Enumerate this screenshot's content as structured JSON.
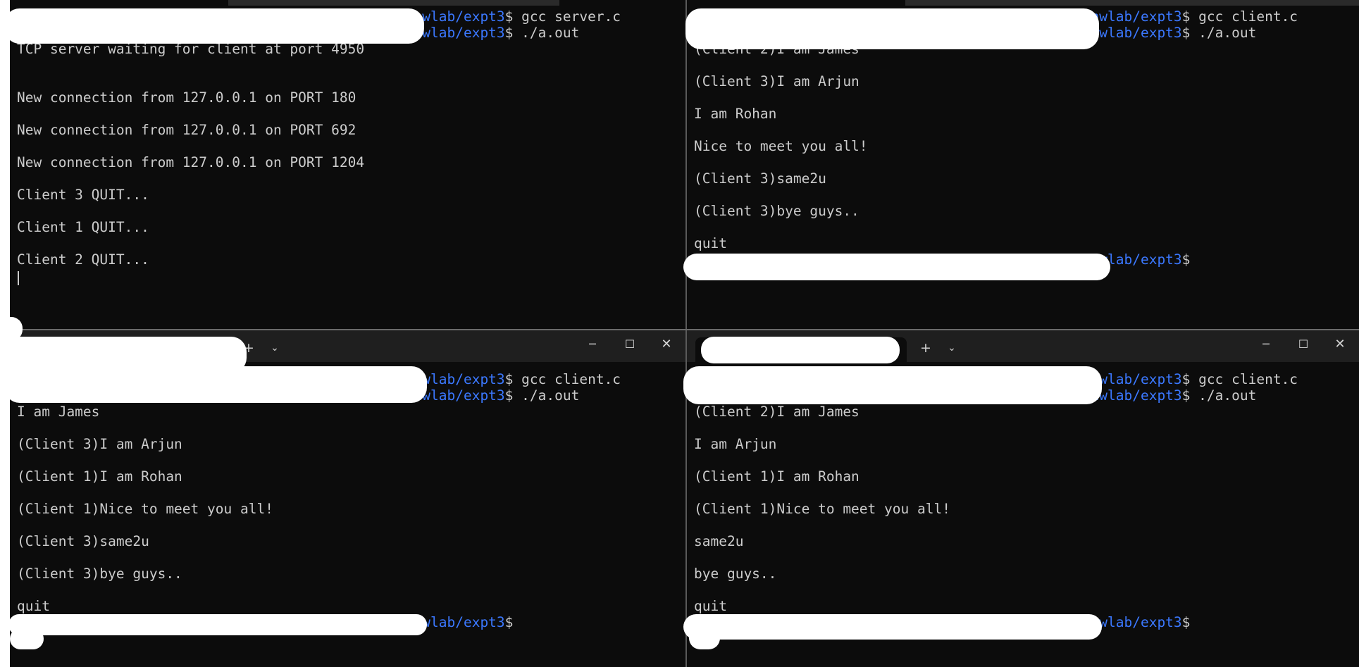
{
  "panes": {
    "tl": {
      "lines": [
        {
          "kind": "prompt",
          "path": "/nwlab/expt3",
          "cmd": "gcc server.c"
        },
        {
          "kind": "prompt",
          "path": "/nwlab/expt3",
          "cmd": "./a.out"
        },
        {
          "kind": "text",
          "text": "TCP server waiting for client at port 4950"
        },
        {
          "kind": "blank"
        },
        {
          "kind": "blank"
        },
        {
          "kind": "text",
          "text": "New connection from 127.0.0.1 on PORT 180"
        },
        {
          "kind": "blank"
        },
        {
          "kind": "text",
          "text": "New connection from 127.0.0.1 on PORT 692"
        },
        {
          "kind": "blank"
        },
        {
          "kind": "text",
          "text": "New connection from 127.0.0.1 on PORT 1204"
        },
        {
          "kind": "blank"
        },
        {
          "kind": "text",
          "text": "Client 3 QUIT..."
        },
        {
          "kind": "blank"
        },
        {
          "kind": "text",
          "text": "Client 1 QUIT..."
        },
        {
          "kind": "blank"
        },
        {
          "kind": "text",
          "text": "Client 2 QUIT..."
        }
      ]
    },
    "tr": {
      "lines": [
        {
          "kind": "prompt",
          "path": "/nwlab/expt3",
          "cmd": "gcc client.c"
        },
        {
          "kind": "prompt",
          "path": "/nwlab/expt3",
          "cmd": "./a.out"
        },
        {
          "kind": "text",
          "text": "(Client 2)I am James"
        },
        {
          "kind": "blank"
        },
        {
          "kind": "text",
          "text": "(Client 3)I am Arjun"
        },
        {
          "kind": "blank"
        },
        {
          "kind": "text",
          "text": "I am Rohan"
        },
        {
          "kind": "blank"
        },
        {
          "kind": "text",
          "text": "Nice to meet you all!"
        },
        {
          "kind": "blank"
        },
        {
          "kind": "text",
          "text": "(Client 3)same2u"
        },
        {
          "kind": "blank"
        },
        {
          "kind": "text",
          "text": "(Client 3)bye guys.."
        },
        {
          "kind": "blank"
        },
        {
          "kind": "text",
          "text": "quit"
        },
        {
          "kind": "prompt",
          "path": "/nwlab/expt3",
          "cmd": ""
        }
      ]
    },
    "bl": {
      "window": {
        "new_tab": "+",
        "dropdown": "⌄",
        "minimize": "─",
        "maximize": "☐",
        "close": "✕"
      },
      "lines": [
        {
          "kind": "prompt",
          "path": "/nwlab/expt3",
          "cmd": "gcc client.c"
        },
        {
          "kind": "prompt",
          "path": "/nwlab/expt3",
          "cmd": "./a.out"
        },
        {
          "kind": "text",
          "text": "I am James"
        },
        {
          "kind": "blank"
        },
        {
          "kind": "text",
          "text": "(Client 3)I am Arjun"
        },
        {
          "kind": "blank"
        },
        {
          "kind": "text",
          "text": "(Client 1)I am Rohan"
        },
        {
          "kind": "blank"
        },
        {
          "kind": "text",
          "text": "(Client 1)Nice to meet you all!"
        },
        {
          "kind": "blank"
        },
        {
          "kind": "text",
          "text": "(Client 3)same2u"
        },
        {
          "kind": "blank"
        },
        {
          "kind": "text",
          "text": "(Client 3)bye guys.."
        },
        {
          "kind": "blank"
        },
        {
          "kind": "text",
          "text": "quit"
        },
        {
          "kind": "prompt",
          "path": "/nwlab/expt3",
          "cmd": ""
        }
      ]
    },
    "br": {
      "window": {
        "new_tab": "+",
        "dropdown": "⌄",
        "minimize": "─",
        "maximize": "☐",
        "close": "✕"
      },
      "lines": [
        {
          "kind": "prompt",
          "path": "/nwlab/expt3",
          "cmd": "gcc client.c"
        },
        {
          "kind": "prompt",
          "path": "/nwlab/expt3",
          "cmd": "./a.out"
        },
        {
          "kind": "text",
          "text": "(Client 2)I am James"
        },
        {
          "kind": "blank"
        },
        {
          "kind": "text",
          "text": "I am Arjun"
        },
        {
          "kind": "blank"
        },
        {
          "kind": "text",
          "text": "(Client 1)I am Rohan"
        },
        {
          "kind": "blank"
        },
        {
          "kind": "text",
          "text": "(Client 1)Nice to meet you all!"
        },
        {
          "kind": "blank"
        },
        {
          "kind": "text",
          "text": "same2u"
        },
        {
          "kind": "blank"
        },
        {
          "kind": "text",
          "text": "bye guys.."
        },
        {
          "kind": "blank"
        },
        {
          "kind": "text",
          "text": "quit"
        },
        {
          "kind": "prompt",
          "path": "/nwlab/expt3",
          "cmd": ""
        }
      ]
    }
  },
  "prompt_symbol": "$",
  "colors": {
    "background": "#0c0c0c",
    "text": "#cccccc",
    "path": "#3b78ff",
    "tabbar": "#1f1f1f",
    "redaction": "#ffffff"
  }
}
